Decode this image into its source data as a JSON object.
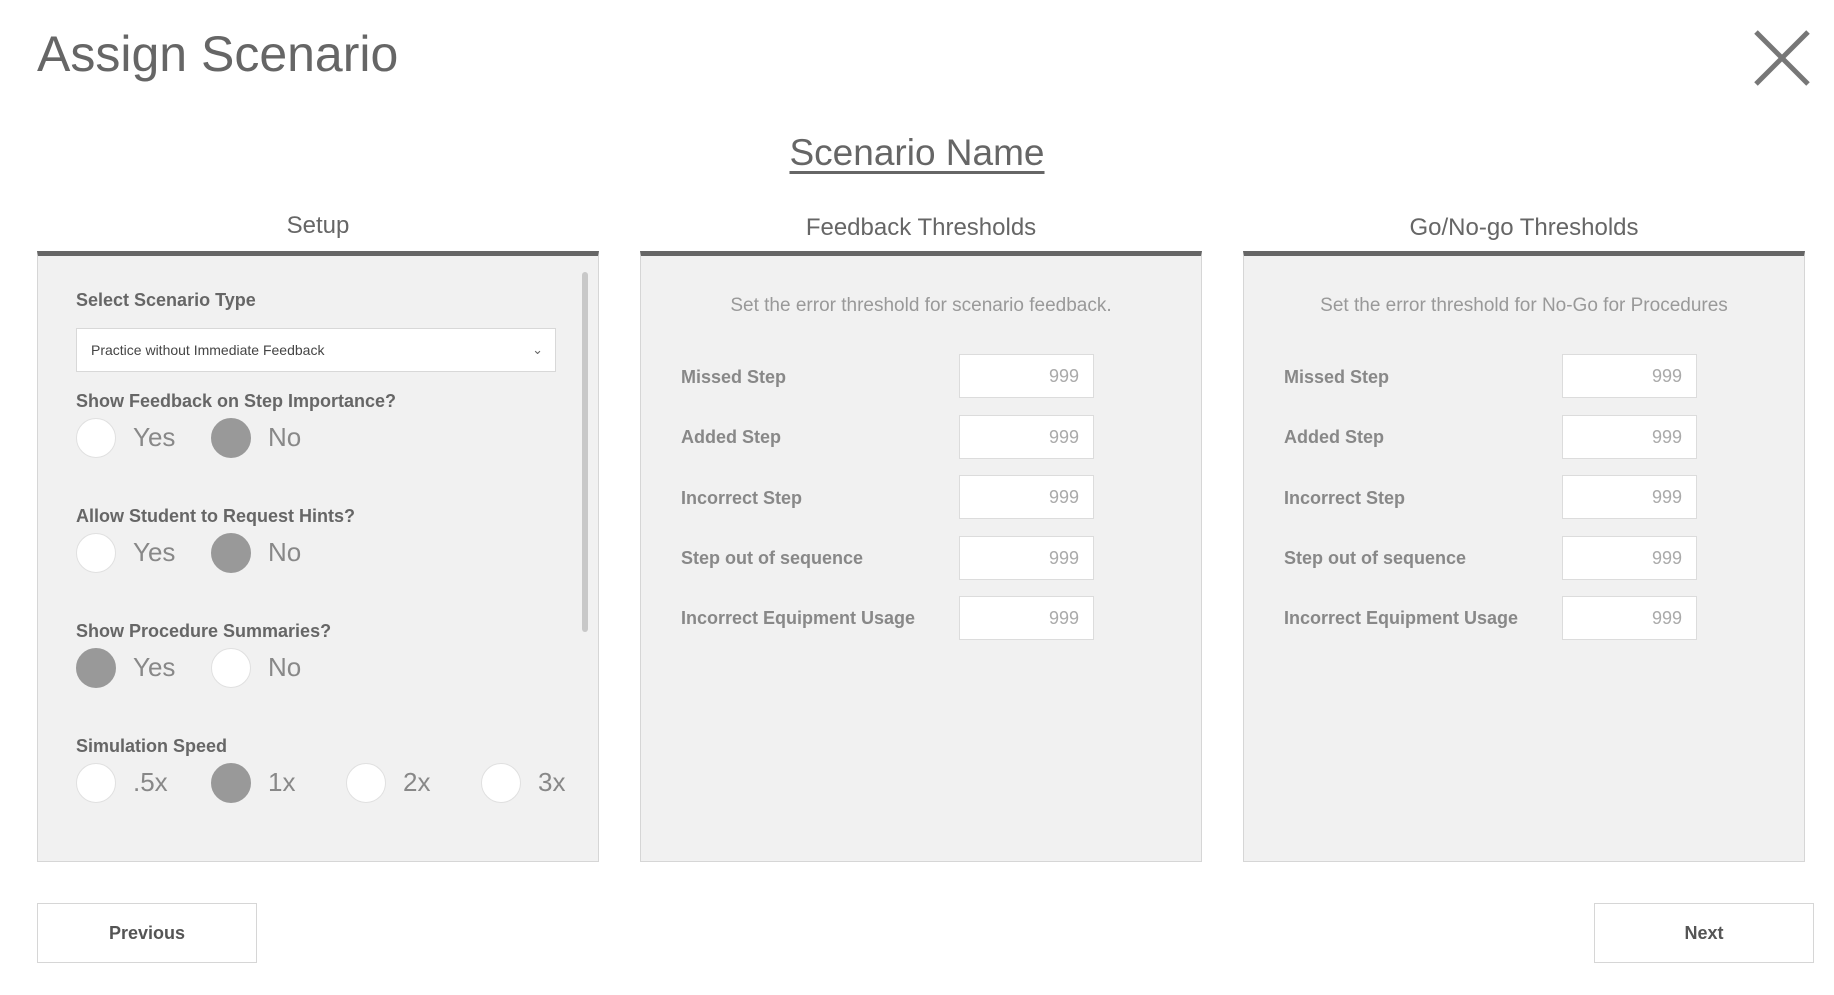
{
  "header": {
    "title": "Assign Scenario"
  },
  "scenario": {
    "name": "Scenario Name"
  },
  "setup": {
    "tab_label": "Setup",
    "scenario_type": {
      "label": "Select Scenario Type",
      "value": "Practice without Immediate Feedback"
    },
    "step_importance": {
      "label": "Show Feedback on Step Importance?",
      "options": [
        "Yes",
        "No"
      ],
      "selected": "No"
    },
    "request_hints": {
      "label": "Allow Student to Request Hints?",
      "options": [
        "Yes",
        "No"
      ],
      "selected": "No"
    },
    "procedure_summaries": {
      "label": "Show Procedure Summaries?",
      "options": [
        "Yes",
        "No"
      ],
      "selected": "Yes"
    },
    "simulation_speed": {
      "label": "Simulation Speed",
      "options": [
        ".5x",
        "1x",
        "2x",
        "3x"
      ],
      "selected": "1x"
    }
  },
  "feedback_thresholds": {
    "tab_label": "Feedback Thresholds",
    "description": "Set the error threshold for scenario feedback.",
    "rows": [
      {
        "label": "Missed Step",
        "value": "999"
      },
      {
        "label": "Added Step",
        "value": "999"
      },
      {
        "label": "Incorrect Step",
        "value": "999"
      },
      {
        "label": "Step out of sequence",
        "value": "999"
      },
      {
        "label": "Incorrect Equipment Usage",
        "value": "999"
      }
    ]
  },
  "gonogo_thresholds": {
    "tab_label": "Go/No-go Thresholds",
    "description": "Set the error threshold for No-Go for Procedures",
    "rows": [
      {
        "label": "Missed Step",
        "value": "999"
      },
      {
        "label": "Added Step",
        "value": "999"
      },
      {
        "label": "Incorrect Step",
        "value": "999"
      },
      {
        "label": "Step out of sequence",
        "value": "999"
      },
      {
        "label": "Incorrect Equipment Usage",
        "value": "999"
      }
    ]
  },
  "footer": {
    "previous_label": "Previous",
    "next_label": "Next"
  },
  "icons": {
    "close": "close-icon",
    "dropdown": "chevron-down-icon"
  },
  "colors": {
    "selected_radio": "#999999",
    "tab_underline": "#666666",
    "panel_bg": "#f1f1f1"
  }
}
